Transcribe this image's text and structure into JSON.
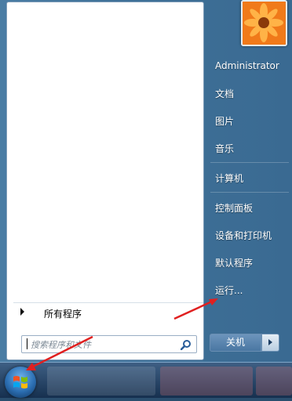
{
  "left_pane": {
    "all_programs": "所有程序",
    "search_placeholder": "搜索程序和文件"
  },
  "right_pane": {
    "items": [
      {
        "label": "Administrator"
      },
      {
        "label": "文档"
      },
      {
        "label": "图片"
      },
      {
        "label": "音乐"
      },
      {
        "label": "计算机"
      },
      {
        "label": "控制面板"
      },
      {
        "label": "设备和打印机"
      },
      {
        "label": "默认程序"
      },
      {
        "label": "运行..."
      }
    ],
    "shutdown_label": "关机"
  },
  "icons": {
    "search": "search-icon",
    "avatar": "user-avatar-flower",
    "start": "windows-start-orb"
  },
  "colors": {
    "annotation_arrow": "#e02020",
    "menu_blue": "#3f7198"
  }
}
